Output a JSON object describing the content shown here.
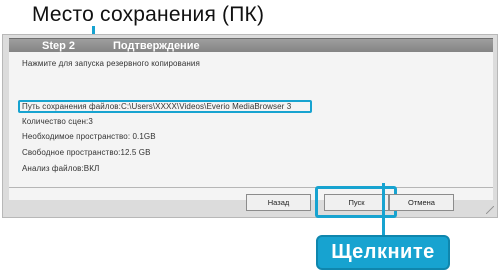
{
  "annotations": {
    "top_callout": "Место сохранения (ПК)",
    "click_callout": "Щелкните"
  },
  "dialog": {
    "step_label": "Step 2",
    "step_title": "Подтверждение",
    "intro": "Нажмите для запуска резервного копирования",
    "save_path": "Путь сохранения файлов:C:\\Users\\XXXX\\Videos\\Everio MediaBrowser 3",
    "scene_count": "Количество сцен:3",
    "required_space": "Необходимое пространство: 0.1GB",
    "free_space": "Свободное пространство:12.5 GB",
    "file_analysis": "Анализ файлов:ВКЛ"
  },
  "buttons": {
    "back": "Назад",
    "start": "Пуск",
    "cancel": "Отмена"
  },
  "colors": {
    "accent": "#17a3d0",
    "header": "#8c8c8c",
    "panel": "#f4f4f4"
  }
}
